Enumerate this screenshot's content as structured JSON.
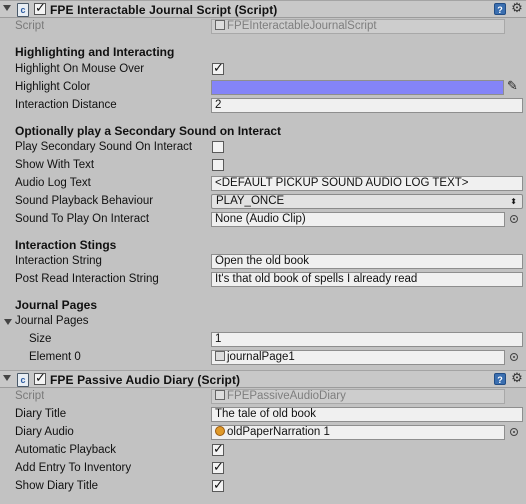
{
  "component1": {
    "title": "FPE Interactable Journal Script (Script)",
    "script_label": "Script",
    "script_value": "FPEInteractableJournalScript",
    "sections": {
      "highlight": "Highlighting and Interacting",
      "sound": "Optionally play a Secondary Sound on Interact",
      "stings": "Interaction Stings",
      "journal": "Journal Pages"
    },
    "highlight_on_mouse_over": {
      "label": "Highlight On Mouse Over",
      "checked": true
    },
    "highlight_color": {
      "label": "Highlight Color",
      "value": "#8484f8"
    },
    "interaction_distance": {
      "label": "Interaction Distance",
      "value": "2"
    },
    "play_secondary_sound": {
      "label": "Play Secondary Sound On Interact",
      "checked": false
    },
    "show_with_text": {
      "label": "Show With Text",
      "checked": false
    },
    "audio_log_text": {
      "label": "Audio Log Text",
      "value": "<DEFAULT PICKUP SOUND AUDIO LOG TEXT>"
    },
    "sound_playback_behaviour": {
      "label": "Sound Playback Behaviour",
      "value": "PLAY_ONCE"
    },
    "sound_to_play": {
      "label": "Sound To Play On Interact",
      "value": "None (Audio Clip)"
    },
    "interaction_string": {
      "label": "Interaction String",
      "value": "Open the old book"
    },
    "post_read_string": {
      "label": "Post Read Interaction String",
      "value": "It's that old book of spells I already read"
    },
    "journal_pages_foldout": "Journal Pages",
    "size": {
      "label": "Size",
      "value": "1"
    },
    "element0": {
      "label": "Element 0",
      "value": "journalPage1"
    }
  },
  "component2": {
    "title": "FPE Passive Audio Diary (Script)",
    "script_label": "Script",
    "script_value": "FPEPassiveAudioDiary",
    "diary_title": {
      "label": "Diary Title",
      "value": "The tale of old book"
    },
    "diary_audio": {
      "label": "Diary Audio",
      "value": "oldPaperNarration 1"
    },
    "automatic_playback": {
      "label": "Automatic Playback",
      "checked": true
    },
    "add_entry": {
      "label": "Add Entry To Inventory",
      "checked": true
    },
    "show_diary_title": {
      "label": "Show Diary Title",
      "checked": true
    }
  },
  "icons": {
    "fold": "triangle-down-icon",
    "script": "script-icon",
    "help": "help-icon",
    "gear": "gear-icon",
    "picker": "object-picker-icon",
    "eyedropper": "eyedropper-icon",
    "scriptable_object": "scriptable-object-icon",
    "audio_clip": "audio-clip-icon"
  }
}
